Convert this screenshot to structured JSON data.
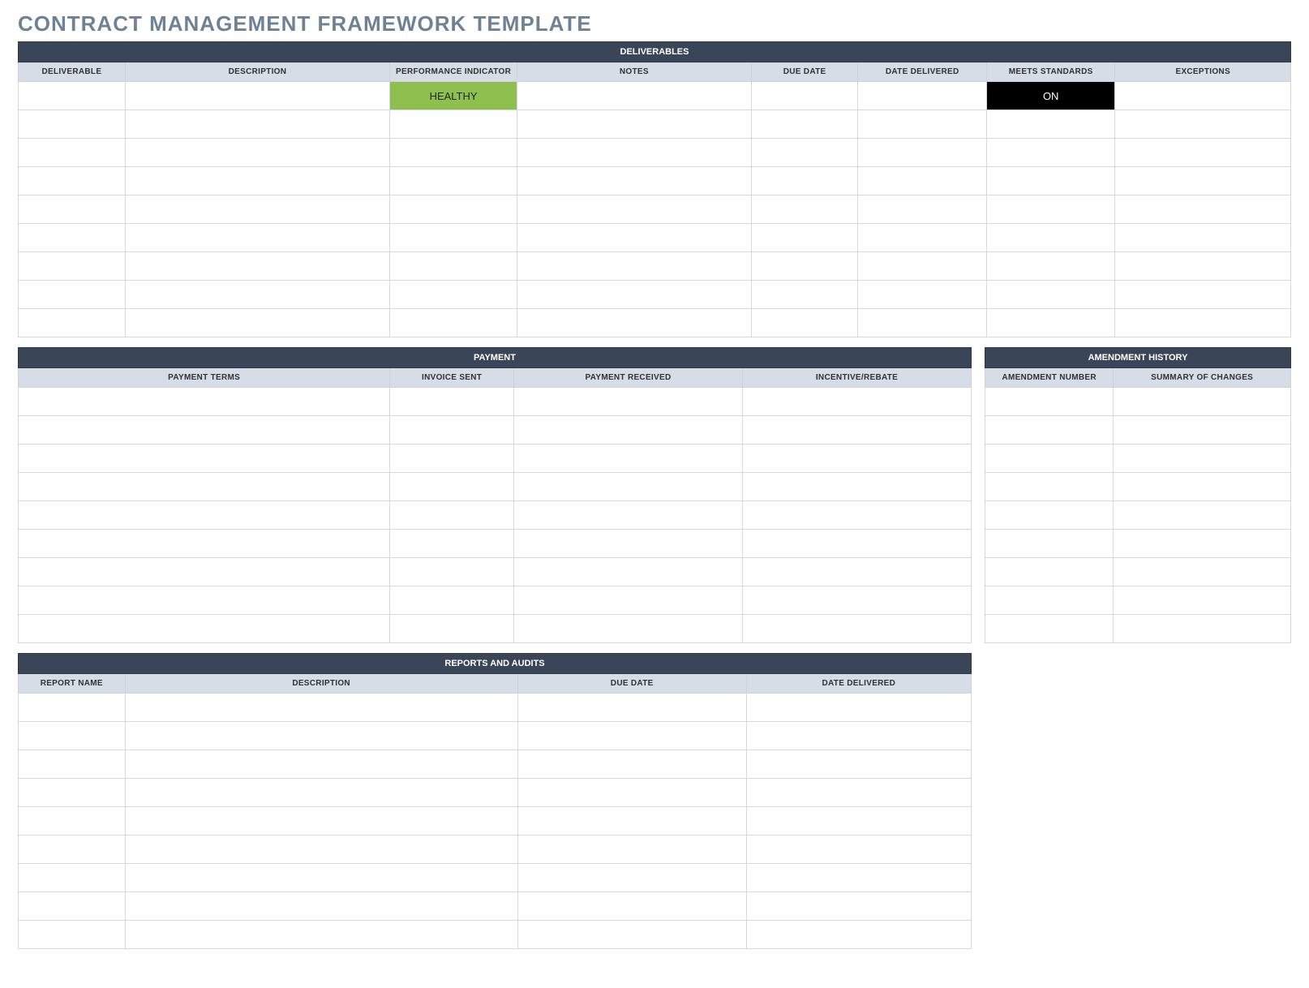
{
  "title": "CONTRACT MANAGEMENT FRAMEWORK TEMPLATE",
  "deliverables": {
    "section_title": "DELIVERABLES",
    "columns": {
      "deliverable": "DELIVERABLE",
      "description": "DESCRIPTION",
      "performance_indicator": "PERFORMANCE INDICATOR",
      "notes": "NOTES",
      "due_date": "DUE DATE",
      "date_delivered": "DATE DELIVERED",
      "meets_standards": "MEETS STANDARDS",
      "exceptions": "EXCEPTIONS"
    },
    "rows": [
      {
        "deliverable": "",
        "description": "",
        "performance_indicator": "HEALTHY",
        "notes": "",
        "due_date": "",
        "date_delivered": "",
        "meets_standards": "ON",
        "exceptions": ""
      },
      {
        "deliverable": "",
        "description": "",
        "performance_indicator": "",
        "notes": "",
        "due_date": "",
        "date_delivered": "",
        "meets_standards": "",
        "exceptions": ""
      },
      {
        "deliverable": "",
        "description": "",
        "performance_indicator": "",
        "notes": "",
        "due_date": "",
        "date_delivered": "",
        "meets_standards": "",
        "exceptions": ""
      },
      {
        "deliverable": "",
        "description": "",
        "performance_indicator": "",
        "notes": "",
        "due_date": "",
        "date_delivered": "",
        "meets_standards": "",
        "exceptions": ""
      },
      {
        "deliverable": "",
        "description": "",
        "performance_indicator": "",
        "notes": "",
        "due_date": "",
        "date_delivered": "",
        "meets_standards": "",
        "exceptions": ""
      },
      {
        "deliverable": "",
        "description": "",
        "performance_indicator": "",
        "notes": "",
        "due_date": "",
        "date_delivered": "",
        "meets_standards": "",
        "exceptions": ""
      },
      {
        "deliverable": "",
        "description": "",
        "performance_indicator": "",
        "notes": "",
        "due_date": "",
        "date_delivered": "",
        "meets_standards": "",
        "exceptions": ""
      },
      {
        "deliverable": "",
        "description": "",
        "performance_indicator": "",
        "notes": "",
        "due_date": "",
        "date_delivered": "",
        "meets_standards": "",
        "exceptions": ""
      },
      {
        "deliverable": "",
        "description": "",
        "performance_indicator": "",
        "notes": "",
        "due_date": "",
        "date_delivered": "",
        "meets_standards": "",
        "exceptions": ""
      }
    ]
  },
  "payment": {
    "section_title": "PAYMENT",
    "columns": {
      "payment_terms": "PAYMENT TERMS",
      "invoice_sent": "INVOICE SENT",
      "payment_received": "PAYMENT RECEIVED",
      "incentive_rebate": "INCENTIVE/REBATE"
    },
    "rows": [
      {
        "payment_terms": "",
        "invoice_sent": "",
        "payment_received": "",
        "incentive_rebate": ""
      },
      {
        "payment_terms": "",
        "invoice_sent": "",
        "payment_received": "",
        "incentive_rebate": ""
      },
      {
        "payment_terms": "",
        "invoice_sent": "",
        "payment_received": "",
        "incentive_rebate": ""
      },
      {
        "payment_terms": "",
        "invoice_sent": "",
        "payment_received": "",
        "incentive_rebate": ""
      },
      {
        "payment_terms": "",
        "invoice_sent": "",
        "payment_received": "",
        "incentive_rebate": ""
      },
      {
        "payment_terms": "",
        "invoice_sent": "",
        "payment_received": "",
        "incentive_rebate": ""
      },
      {
        "payment_terms": "",
        "invoice_sent": "",
        "payment_received": "",
        "incentive_rebate": ""
      },
      {
        "payment_terms": "",
        "invoice_sent": "",
        "payment_received": "",
        "incentive_rebate": ""
      },
      {
        "payment_terms": "",
        "invoice_sent": "",
        "payment_received": "",
        "incentive_rebate": ""
      }
    ]
  },
  "amendment": {
    "section_title": "AMENDMENT HISTORY",
    "columns": {
      "amendment_number": "AMENDMENT NUMBER",
      "summary_of_changes": "SUMMARY OF CHANGES"
    },
    "rows": [
      {
        "amendment_number": "",
        "summary_of_changes": ""
      },
      {
        "amendment_number": "",
        "summary_of_changes": ""
      },
      {
        "amendment_number": "",
        "summary_of_changes": ""
      },
      {
        "amendment_number": "",
        "summary_of_changes": ""
      },
      {
        "amendment_number": "",
        "summary_of_changes": ""
      },
      {
        "amendment_number": "",
        "summary_of_changes": ""
      },
      {
        "amendment_number": "",
        "summary_of_changes": ""
      },
      {
        "amendment_number": "",
        "summary_of_changes": ""
      },
      {
        "amendment_number": "",
        "summary_of_changes": ""
      }
    ]
  },
  "reports": {
    "section_title": "REPORTS AND AUDITS",
    "columns": {
      "report_name": "REPORT NAME",
      "description": "DESCRIPTION",
      "due_date": "DUE DATE",
      "date_delivered": "DATE DELIVERED"
    },
    "rows": [
      {
        "report_name": "",
        "description": "",
        "due_date": "",
        "date_delivered": ""
      },
      {
        "report_name": "",
        "description": "",
        "due_date": "",
        "date_delivered": ""
      },
      {
        "report_name": "",
        "description": "",
        "due_date": "",
        "date_delivered": ""
      },
      {
        "report_name": "",
        "description": "",
        "due_date": "",
        "date_delivered": ""
      },
      {
        "report_name": "",
        "description": "",
        "due_date": "",
        "date_delivered": ""
      },
      {
        "report_name": "",
        "description": "",
        "due_date": "",
        "date_delivered": ""
      },
      {
        "report_name": "",
        "description": "",
        "due_date": "",
        "date_delivered": ""
      },
      {
        "report_name": "",
        "description": "",
        "due_date": "",
        "date_delivered": ""
      },
      {
        "report_name": "",
        "description": "",
        "due_date": "",
        "date_delivered": ""
      }
    ]
  }
}
